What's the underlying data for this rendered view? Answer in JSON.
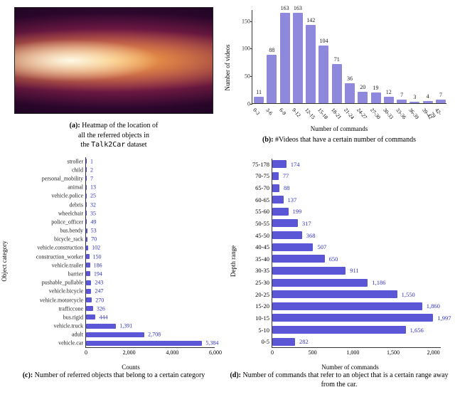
{
  "a": {
    "caption_label": "(a):",
    "caption_l1": "Heatmap of the location of",
    "caption_l2": "all the referred objects in",
    "caption_l3": "the",
    "caption_dataset": "Talk2Car",
    "caption_l3b": "dataset"
  },
  "b": {
    "caption_label": "(b):",
    "caption": "#Videos that have a certain number of commands",
    "ylabel": "Number of videos",
    "xlabel": "Number of commands"
  },
  "c": {
    "caption_label": "(c):",
    "caption": "Number of referred objects that belong to a certain category",
    "ylabel": "Object category",
    "xlabel": "Counts"
  },
  "d": {
    "caption_label": "(d):",
    "caption": "Number of commands that refer to an object that is a certain range away from the car.",
    "ylabel": "Depth range",
    "xlabel": "Number of commands"
  },
  "chart_data": [
    {
      "id": "b",
      "type": "bar",
      "orientation": "vertical",
      "xlabel": "Number of commands",
      "ylabel": "Number of videos",
      "ylim": [
        0,
        170
      ],
      "yticks": [
        0,
        50,
        100,
        150
      ],
      "categories": [
        "0-3",
        "3-6",
        "6-9",
        "9-12",
        "12-15",
        "15-18",
        "18-21",
        "21-24",
        "24-27",
        "27-30",
        "30-33",
        "33-36",
        "36-39",
        "39-42",
        "42-79"
      ],
      "values": [
        11,
        88,
        163,
        163,
        142,
        104,
        71,
        36,
        20,
        19,
        12,
        7,
        3,
        4,
        7
      ]
    },
    {
      "id": "c",
      "type": "bar",
      "orientation": "horizontal",
      "xlabel": "Counts",
      "ylabel": "Object category",
      "xlim": [
        0,
        6000
      ],
      "xticks": [
        0,
        2000,
        4000,
        6000
      ],
      "categories": [
        "stroller",
        "child",
        "personal_mobility",
        "animal",
        "vehicle.police",
        "debris",
        "wheelchair",
        "police_officer",
        "bus.bendy",
        "bicycle_rack",
        "vehicle.construction",
        "construction_worker",
        "vehicle.trailer",
        "barrier",
        "pushable_pullable",
        "vehicle.bicycle",
        "vehicle.motorcycle",
        "trafficcone",
        "bus.rigid",
        "vehicle.truck",
        "adult",
        "vehicle.car"
      ],
      "values": [
        1,
        2,
        7,
        13,
        25,
        32,
        35,
        49,
        53,
        70,
        102,
        150,
        186,
        194,
        243,
        247,
        270,
        326,
        444,
        1391,
        2708,
        5384
      ]
    },
    {
      "id": "d",
      "type": "bar",
      "orientation": "horizontal",
      "xlabel": "Number of commands",
      "ylabel": "Depth range",
      "xlim": [
        0,
        2100
      ],
      "xticks": [
        0,
        500,
        1000,
        1500,
        2000
      ],
      "categories": [
        "75-178",
        "70-75",
        "65-70",
        "60-65",
        "55-60",
        "50-55",
        "45-50",
        "40-45",
        "35-40",
        "30-35",
        "25-30",
        "20-25",
        "15-20",
        "10-15",
        "5-10",
        "0-5"
      ],
      "values": [
        174,
        77,
        88,
        137,
        199,
        317,
        368,
        507,
        650,
        911,
        1186,
        1550,
        1860,
        1997,
        1656,
        282
      ]
    }
  ]
}
